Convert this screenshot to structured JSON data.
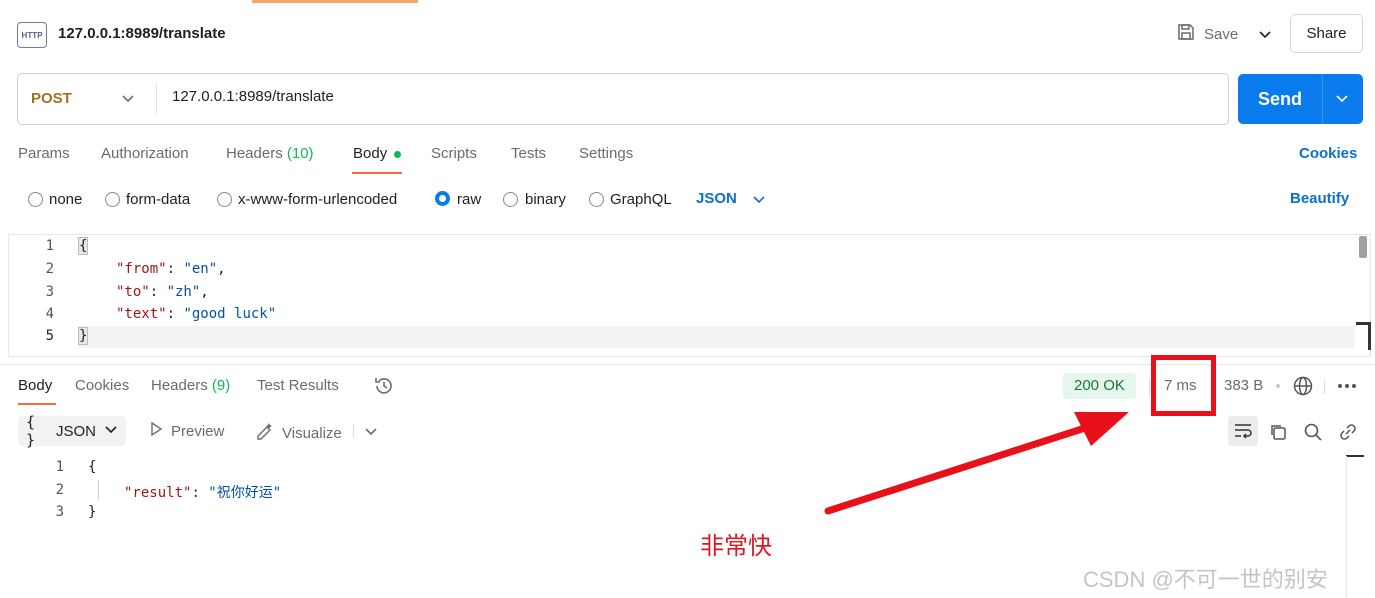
{
  "request": {
    "title": "127.0.0.1:8989/translate",
    "icon_text": "HTTP",
    "save_label": "Save",
    "share_label": "Share",
    "method": "POST",
    "url": "127.0.0.1:8989/translate",
    "send_label": "Send"
  },
  "request_tabs": {
    "params": "Params",
    "authorization": "Authorization",
    "headers": "Headers",
    "headers_count": "(10)",
    "body": "Body",
    "scripts": "Scripts",
    "tests": "Tests",
    "settings": "Settings",
    "cookies": "Cookies",
    "active": "Body"
  },
  "body_options": {
    "none": "none",
    "form_data": "form-data",
    "urlencoded": "x-www-form-urlencoded",
    "raw": "raw",
    "binary": "binary",
    "graphql": "GraphQL",
    "selected": "raw",
    "format": "JSON",
    "beautify": "Beautify"
  },
  "editor": {
    "line_numbers": [
      "1",
      "2",
      "3",
      "4",
      "5"
    ],
    "open_brace": "{",
    "close_brace": "}",
    "colon": ": ",
    "comma": ",",
    "entries": [
      {
        "key": "\"from\"",
        "value": "\"en\""
      },
      {
        "key": "\"to\"",
        "value": "\"zh\""
      },
      {
        "key": "\"text\"",
        "value": "\"good luck\""
      }
    ]
  },
  "response_tabs": {
    "body": "Body",
    "cookies": "Cookies",
    "headers": "Headers",
    "headers_count": "(9)",
    "test_results": "Test Results",
    "active": "Body"
  },
  "response_meta": {
    "status": "200 OK",
    "time": "7 ms",
    "size": "383 B"
  },
  "response_toolbar": {
    "format_icon": "{ }",
    "format": "JSON",
    "preview": "Preview",
    "visualize": "Visualize"
  },
  "response_body": {
    "line_numbers": [
      "1",
      "2",
      "3"
    ],
    "open_brace": "{",
    "close_brace": "}",
    "key": "\"result\"",
    "colon": ": ",
    "value": "\"祝你好运\""
  },
  "annotation": "非常快",
  "watermark": "CSDN @不可一世的别安",
  "colors": {
    "accent_orange": "#f26b3a",
    "send_blue": "#097bed",
    "link_blue": "#0b6fcf",
    "status_green": "#127a3a",
    "annotation_red": "#e8101b"
  },
  "icons": [
    "http-request-icon",
    "save-icon",
    "chevron-down-icon",
    "history-icon",
    "globe-icon",
    "more-icon",
    "preview-icon",
    "visualize-icon",
    "wrap-lines-icon",
    "copy-icon",
    "search-icon",
    "link-icon",
    "red-arrow"
  ]
}
